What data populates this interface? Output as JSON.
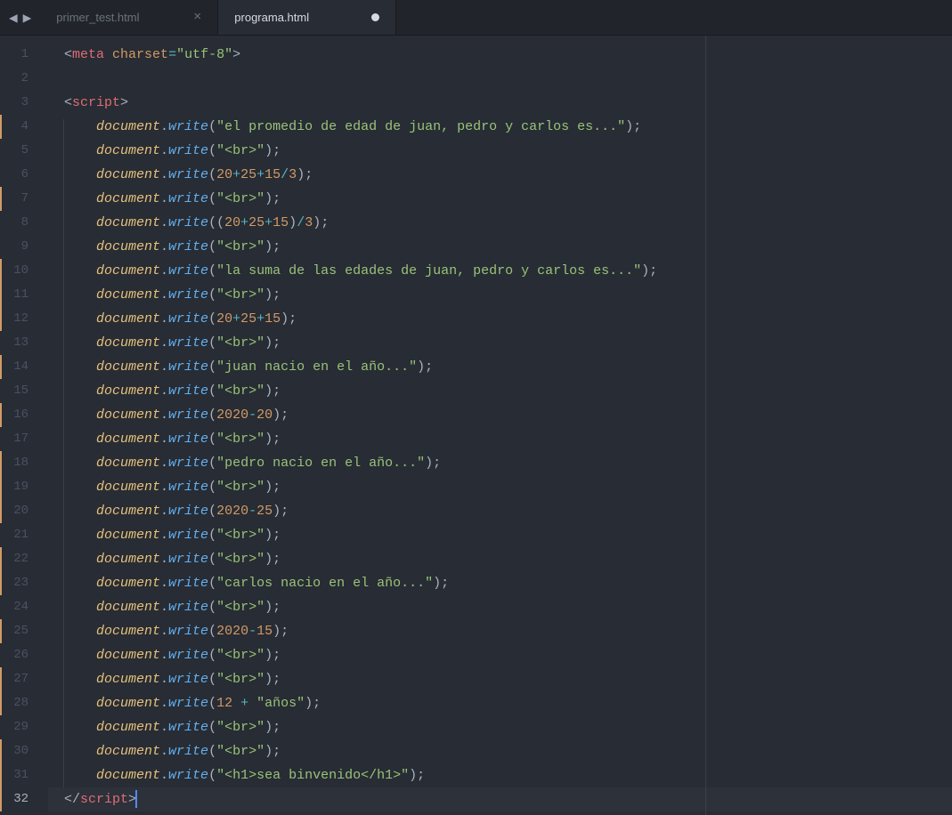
{
  "tabs": [
    {
      "title": "primer_test.html",
      "active": false,
      "modified": false
    },
    {
      "title": "programa.html",
      "active": true,
      "modified": true
    }
  ],
  "nav": {
    "back": "◀",
    "forward": "▶"
  },
  "gutter": {
    "first": 1,
    "last": 32,
    "active": 32,
    "modified_ranges": [
      [
        4,
        4
      ],
      [
        7,
        7
      ],
      [
        10,
        12
      ],
      [
        14,
        14
      ],
      [
        16,
        16
      ],
      [
        18,
        20
      ],
      [
        22,
        23
      ],
      [
        25,
        25
      ],
      [
        27,
        28
      ],
      [
        30,
        32
      ]
    ]
  },
  "code": [
    {
      "n": 1,
      "indent": 0,
      "tokens": [
        [
          "punct",
          "<"
        ],
        [
          "tag",
          "meta"
        ],
        [
          "plain",
          " "
        ],
        [
          "attr",
          "charset"
        ],
        [
          "op",
          "="
        ],
        [
          "str",
          "\"utf-8\""
        ],
        [
          "punct",
          ">"
        ]
      ]
    },
    {
      "n": 2,
      "indent": 0,
      "tokens": []
    },
    {
      "n": 3,
      "indent": 0,
      "tokens": [
        [
          "punct",
          "<"
        ],
        [
          "tag",
          "script"
        ],
        [
          "punct",
          ">"
        ]
      ]
    },
    {
      "n": 4,
      "indent": 1,
      "tokens": [
        [
          "var",
          "document"
        ],
        [
          "punct",
          "."
        ],
        [
          "method",
          "write"
        ],
        [
          "bracket",
          "("
        ],
        [
          "str",
          "\"el promedio de edad de juan, pedro y carlos es...\""
        ],
        [
          "bracket",
          ")"
        ],
        [
          "punct",
          ";"
        ]
      ]
    },
    {
      "n": 5,
      "indent": 1,
      "tokens": [
        [
          "var",
          "document"
        ],
        [
          "punct",
          "."
        ],
        [
          "method",
          "write"
        ],
        [
          "bracket",
          "("
        ],
        [
          "str",
          "\"<br>\""
        ],
        [
          "bracket",
          ")"
        ],
        [
          "punct",
          ";"
        ]
      ]
    },
    {
      "n": 6,
      "indent": 1,
      "tokens": [
        [
          "var",
          "document"
        ],
        [
          "punct",
          "."
        ],
        [
          "method",
          "write"
        ],
        [
          "bracket",
          "("
        ],
        [
          "num",
          "20"
        ],
        [
          "op",
          "+"
        ],
        [
          "num",
          "25"
        ],
        [
          "op",
          "+"
        ],
        [
          "num",
          "15"
        ],
        [
          "op",
          "/"
        ],
        [
          "num",
          "3"
        ],
        [
          "bracket",
          ")"
        ],
        [
          "punct",
          ";"
        ]
      ]
    },
    {
      "n": 7,
      "indent": 1,
      "tokens": [
        [
          "var",
          "document"
        ],
        [
          "punct",
          "."
        ],
        [
          "method",
          "write"
        ],
        [
          "bracket",
          "("
        ],
        [
          "str",
          "\"<br>\""
        ],
        [
          "bracket",
          ")"
        ],
        [
          "punct",
          ";"
        ]
      ]
    },
    {
      "n": 8,
      "indent": 1,
      "tokens": [
        [
          "var",
          "document"
        ],
        [
          "punct",
          "."
        ],
        [
          "method",
          "write"
        ],
        [
          "bracket",
          "("
        ],
        [
          "bracket",
          "("
        ],
        [
          "num",
          "20"
        ],
        [
          "op",
          "+"
        ],
        [
          "num",
          "25"
        ],
        [
          "op",
          "+"
        ],
        [
          "num",
          "15"
        ],
        [
          "bracket",
          ")"
        ],
        [
          "op",
          "/"
        ],
        [
          "num",
          "3"
        ],
        [
          "bracket",
          ")"
        ],
        [
          "punct",
          ";"
        ]
      ]
    },
    {
      "n": 9,
      "indent": 1,
      "tokens": [
        [
          "var",
          "document"
        ],
        [
          "punct",
          "."
        ],
        [
          "method",
          "write"
        ],
        [
          "bracket",
          "("
        ],
        [
          "str",
          "\"<br>\""
        ],
        [
          "bracket",
          ")"
        ],
        [
          "punct",
          ";"
        ]
      ]
    },
    {
      "n": 10,
      "indent": 1,
      "tokens": [
        [
          "var",
          "document"
        ],
        [
          "punct",
          "."
        ],
        [
          "method",
          "write"
        ],
        [
          "bracket",
          "("
        ],
        [
          "str",
          "\"la suma de las edades de juan, pedro y carlos es...\""
        ],
        [
          "bracket",
          ")"
        ],
        [
          "punct",
          ";"
        ]
      ]
    },
    {
      "n": 11,
      "indent": 1,
      "tokens": [
        [
          "var",
          "document"
        ],
        [
          "punct",
          "."
        ],
        [
          "method",
          "write"
        ],
        [
          "bracket",
          "("
        ],
        [
          "str",
          "\"<br>\""
        ],
        [
          "bracket",
          ")"
        ],
        [
          "punct",
          ";"
        ]
      ]
    },
    {
      "n": 12,
      "indent": 1,
      "tokens": [
        [
          "var",
          "document"
        ],
        [
          "punct",
          "."
        ],
        [
          "method",
          "write"
        ],
        [
          "bracket",
          "("
        ],
        [
          "num",
          "20"
        ],
        [
          "op",
          "+"
        ],
        [
          "num",
          "25"
        ],
        [
          "op",
          "+"
        ],
        [
          "num",
          "15"
        ],
        [
          "bracket",
          ")"
        ],
        [
          "punct",
          ";"
        ]
      ]
    },
    {
      "n": 13,
      "indent": 1,
      "tokens": [
        [
          "var",
          "document"
        ],
        [
          "punct",
          "."
        ],
        [
          "method",
          "write"
        ],
        [
          "bracket",
          "("
        ],
        [
          "str",
          "\"<br>\""
        ],
        [
          "bracket",
          ")"
        ],
        [
          "punct",
          ";"
        ]
      ]
    },
    {
      "n": 14,
      "indent": 1,
      "tokens": [
        [
          "var",
          "document"
        ],
        [
          "punct",
          "."
        ],
        [
          "method",
          "write"
        ],
        [
          "bracket",
          "("
        ],
        [
          "str",
          "\"juan nacio en el año...\""
        ],
        [
          "bracket",
          ")"
        ],
        [
          "punct",
          ";"
        ]
      ]
    },
    {
      "n": 15,
      "indent": 1,
      "tokens": [
        [
          "var",
          "document"
        ],
        [
          "punct",
          "."
        ],
        [
          "method",
          "write"
        ],
        [
          "bracket",
          "("
        ],
        [
          "str",
          "\"<br>\""
        ],
        [
          "bracket",
          ")"
        ],
        [
          "punct",
          ";"
        ]
      ]
    },
    {
      "n": 16,
      "indent": 1,
      "tokens": [
        [
          "var",
          "document"
        ],
        [
          "punct",
          "."
        ],
        [
          "method",
          "write"
        ],
        [
          "bracket",
          "("
        ],
        [
          "num",
          "2020"
        ],
        [
          "op",
          "-"
        ],
        [
          "num",
          "20"
        ],
        [
          "bracket",
          ")"
        ],
        [
          "punct",
          ";"
        ]
      ]
    },
    {
      "n": 17,
      "indent": 1,
      "tokens": [
        [
          "var",
          "document"
        ],
        [
          "punct",
          "."
        ],
        [
          "method",
          "write"
        ],
        [
          "bracket",
          "("
        ],
        [
          "str",
          "\"<br>\""
        ],
        [
          "bracket",
          ")"
        ],
        [
          "punct",
          ";"
        ]
      ]
    },
    {
      "n": 18,
      "indent": 1,
      "tokens": [
        [
          "var",
          "document"
        ],
        [
          "punct",
          "."
        ],
        [
          "method",
          "write"
        ],
        [
          "bracket",
          "("
        ],
        [
          "str",
          "\"pedro nacio en el año...\""
        ],
        [
          "bracket",
          ")"
        ],
        [
          "punct",
          ";"
        ]
      ]
    },
    {
      "n": 19,
      "indent": 1,
      "tokens": [
        [
          "var",
          "document"
        ],
        [
          "punct",
          "."
        ],
        [
          "method",
          "write"
        ],
        [
          "bracket",
          "("
        ],
        [
          "str",
          "\"<br>\""
        ],
        [
          "bracket",
          ")"
        ],
        [
          "punct",
          ";"
        ]
      ]
    },
    {
      "n": 20,
      "indent": 1,
      "tokens": [
        [
          "var",
          "document"
        ],
        [
          "punct",
          "."
        ],
        [
          "method",
          "write"
        ],
        [
          "bracket",
          "("
        ],
        [
          "num",
          "2020"
        ],
        [
          "op",
          "-"
        ],
        [
          "num",
          "25"
        ],
        [
          "bracket",
          ")"
        ],
        [
          "punct",
          ";"
        ]
      ]
    },
    {
      "n": 21,
      "indent": 1,
      "tokens": [
        [
          "var",
          "document"
        ],
        [
          "punct",
          "."
        ],
        [
          "method",
          "write"
        ],
        [
          "bracket",
          "("
        ],
        [
          "str",
          "\"<br>\""
        ],
        [
          "bracket",
          ")"
        ],
        [
          "punct",
          ";"
        ]
      ]
    },
    {
      "n": 22,
      "indent": 1,
      "tokens": [
        [
          "var",
          "document"
        ],
        [
          "punct",
          "."
        ],
        [
          "method",
          "write"
        ],
        [
          "bracket",
          "("
        ],
        [
          "str",
          "\"<br>\""
        ],
        [
          "bracket",
          ")"
        ],
        [
          "punct",
          ";"
        ]
      ]
    },
    {
      "n": 23,
      "indent": 1,
      "tokens": [
        [
          "var",
          "document"
        ],
        [
          "punct",
          "."
        ],
        [
          "method",
          "write"
        ],
        [
          "bracket",
          "("
        ],
        [
          "str",
          "\"carlos nacio en el año...\""
        ],
        [
          "bracket",
          ")"
        ],
        [
          "punct",
          ";"
        ]
      ]
    },
    {
      "n": 24,
      "indent": 1,
      "tokens": [
        [
          "var",
          "document"
        ],
        [
          "punct",
          "."
        ],
        [
          "method",
          "write"
        ],
        [
          "bracket",
          "("
        ],
        [
          "str",
          "\"<br>\""
        ],
        [
          "bracket",
          ")"
        ],
        [
          "punct",
          ";"
        ]
      ]
    },
    {
      "n": 25,
      "indent": 1,
      "tokens": [
        [
          "var",
          "document"
        ],
        [
          "punct",
          "."
        ],
        [
          "method",
          "write"
        ],
        [
          "bracket",
          "("
        ],
        [
          "num",
          "2020"
        ],
        [
          "op",
          "-"
        ],
        [
          "num",
          "15"
        ],
        [
          "bracket",
          ")"
        ],
        [
          "punct",
          ";"
        ]
      ]
    },
    {
      "n": 26,
      "indent": 1,
      "tokens": [
        [
          "var",
          "document"
        ],
        [
          "punct",
          "."
        ],
        [
          "method",
          "write"
        ],
        [
          "bracket",
          "("
        ],
        [
          "str",
          "\"<br>\""
        ],
        [
          "bracket",
          ")"
        ],
        [
          "punct",
          ";"
        ]
      ]
    },
    {
      "n": 27,
      "indent": 1,
      "tokens": [
        [
          "var",
          "document"
        ],
        [
          "punct",
          "."
        ],
        [
          "method",
          "write"
        ],
        [
          "bracket",
          "("
        ],
        [
          "str",
          "\"<br>\""
        ],
        [
          "bracket",
          ")"
        ],
        [
          "punct",
          ";"
        ]
      ]
    },
    {
      "n": 28,
      "indent": 1,
      "tokens": [
        [
          "var",
          "document"
        ],
        [
          "punct",
          "."
        ],
        [
          "method",
          "write"
        ],
        [
          "bracket",
          "("
        ],
        [
          "num",
          "12"
        ],
        [
          "plain",
          " "
        ],
        [
          "op",
          "+"
        ],
        [
          "plain",
          " "
        ],
        [
          "str",
          "\"años\""
        ],
        [
          "bracket",
          ")"
        ],
        [
          "punct",
          ";"
        ]
      ]
    },
    {
      "n": 29,
      "indent": 1,
      "tokens": [
        [
          "var",
          "document"
        ],
        [
          "punct",
          "."
        ],
        [
          "method",
          "write"
        ],
        [
          "bracket",
          "("
        ],
        [
          "str",
          "\"<br>\""
        ],
        [
          "bracket",
          ")"
        ],
        [
          "punct",
          ";"
        ]
      ]
    },
    {
      "n": 30,
      "indent": 1,
      "tokens": [
        [
          "var",
          "document"
        ],
        [
          "punct",
          "."
        ],
        [
          "method",
          "write"
        ],
        [
          "bracket",
          "("
        ],
        [
          "str",
          "\"<br>\""
        ],
        [
          "bracket",
          ")"
        ],
        [
          "punct",
          ";"
        ]
      ]
    },
    {
      "n": 31,
      "indent": 1,
      "tokens": [
        [
          "var",
          "document"
        ],
        [
          "punct",
          "."
        ],
        [
          "method",
          "write"
        ],
        [
          "bracket",
          "("
        ],
        [
          "str",
          "\"<h1>sea binvenido</h1>\""
        ],
        [
          "bracket",
          ")"
        ],
        [
          "punct",
          ";"
        ]
      ]
    },
    {
      "n": 32,
      "indent": 0,
      "tokens": [
        [
          "punct",
          "</"
        ],
        [
          "tag",
          "script"
        ],
        [
          "punct",
          ">"
        ]
      ],
      "cursor_after": true
    }
  ]
}
